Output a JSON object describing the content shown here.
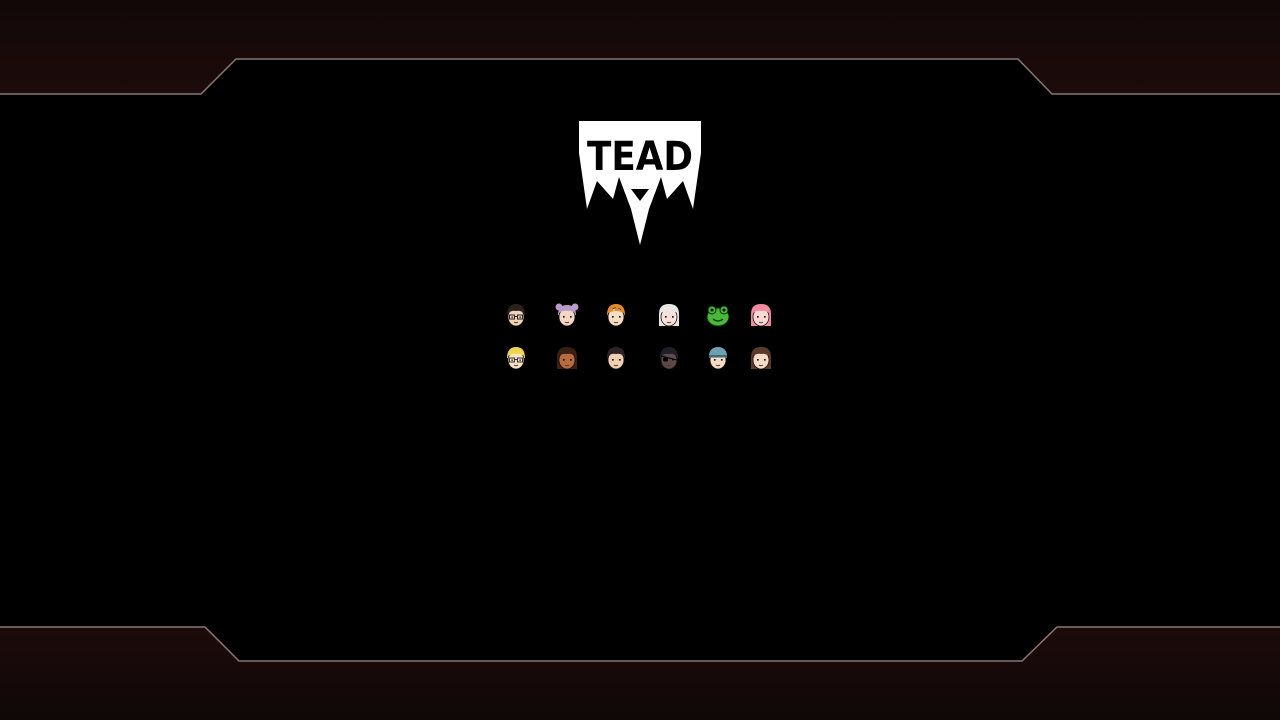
{
  "screen": {
    "background_color": "#000000",
    "frame_band_color": "#1a0a0a",
    "frame_outline_color": "#8a7474"
  },
  "logo": {
    "text": "TEAD",
    "color": "#ffffff",
    "ink_color": "#000000"
  },
  "characters": {
    "row_1": [
      {
        "name": "glasses-dark-hair",
        "hair": "#2a2020",
        "skin": "#f3d3b8",
        "accent": "#222222",
        "style": "glasses"
      },
      {
        "name": "lavender-pigtails",
        "hair": "#b89bc7",
        "skin": "#f4d6c4",
        "accent": "#8c6f9c",
        "style": "buns"
      },
      {
        "name": "orange-hair",
        "hair": "#e08a2c",
        "skin": "#f6dcc3",
        "accent": "#b56a1e",
        "style": "spiky"
      },
      {
        "name": "white-hair",
        "hair": "#e8e6e6",
        "skin": "#f7e2da",
        "accent": "#b7a8a8",
        "style": "long"
      },
      {
        "name": "frog",
        "hair": "#3aa52a",
        "skin": "#48b838",
        "accent": "#1d5e15",
        "style": "frog"
      },
      {
        "name": "pink-hair",
        "hair": "#f28ba0",
        "skin": "#fbd9d3",
        "accent": "#d3617a",
        "style": "long"
      }
    ],
    "row_2": [
      {
        "name": "blonde-glasses",
        "hair": "#f0d44a",
        "skin": "#f7e3c7",
        "accent": "#333333",
        "style": "glasses"
      },
      {
        "name": "curly-dark-skin",
        "hair": "#3b1e14",
        "skin": "#b86c3e",
        "accent": "#2a1208",
        "style": "long"
      },
      {
        "name": "dark-hair-bangs",
        "hair": "#2c2424",
        "skin": "#f0cfb3",
        "accent": "#1a1414",
        "style": "short"
      },
      {
        "name": "eyepatch",
        "hair": "#1f1f2a",
        "skin": "#5a4a4a",
        "accent": "#0d0d14",
        "style": "eyepatch"
      },
      {
        "name": "cap-wearer",
        "hair": "#6fa0b0",
        "skin": "#f5dcc6",
        "accent": "#3f6a78",
        "style": "cap"
      },
      {
        "name": "brown-long-hair",
        "hair": "#5b3a2a",
        "skin": "#f4dcc7",
        "accent": "#3a2418",
        "style": "long"
      }
    ]
  }
}
